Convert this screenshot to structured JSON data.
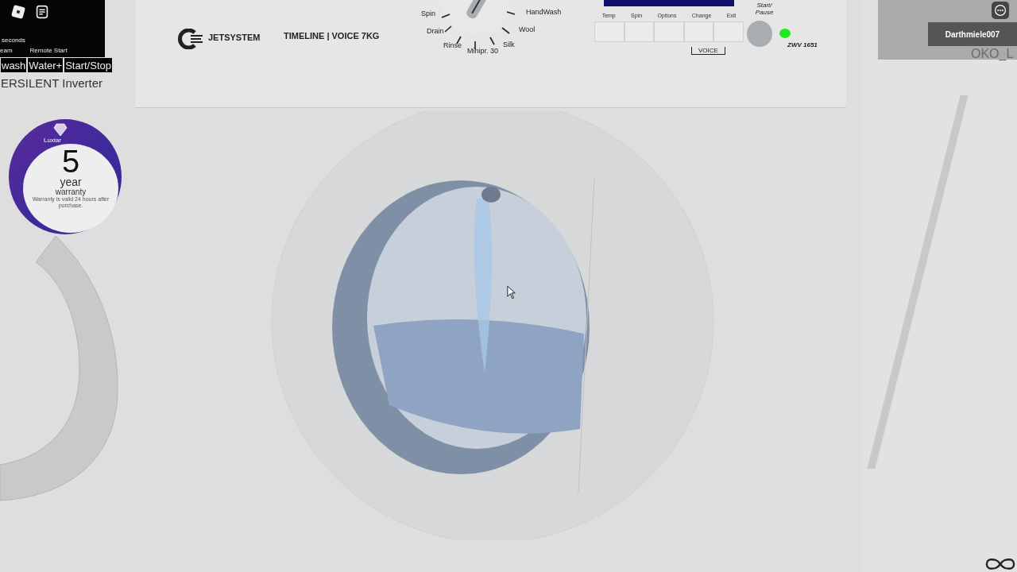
{
  "hud": {
    "username": "Darthmiele007",
    "background_text": "OKO_L"
  },
  "left_machine": {
    "display_text": "seconds",
    "panel_labels": [
      "eam",
      "Remote Start"
    ],
    "buttons": [
      "wash",
      "Water+",
      "Start/Stop"
    ],
    "model": "ERSILENT Inverter"
  },
  "warranty_sticker": {
    "brand": "Luxiar",
    "number": "5",
    "unit": "year",
    "label": "warranty",
    "note": "Warranty is valid 24 hours after purchase."
  },
  "main_machine": {
    "brand": "JETSYSTEM",
    "series": "TIMELINE | VOICE 7KG",
    "dial_programs": [
      "Spin",
      "Drain",
      "Rinse",
      "Minipr. 30",
      "Silk",
      "Wool",
      "HandWash"
    ],
    "soft_keys": [
      "Temp",
      "Spin",
      "Options",
      "Change",
      "Exit"
    ],
    "voice_label": "VOICE",
    "start_label": "Start/ Pause",
    "power_light": {
      "on": true
    },
    "model": "ZWV 1651"
  }
}
